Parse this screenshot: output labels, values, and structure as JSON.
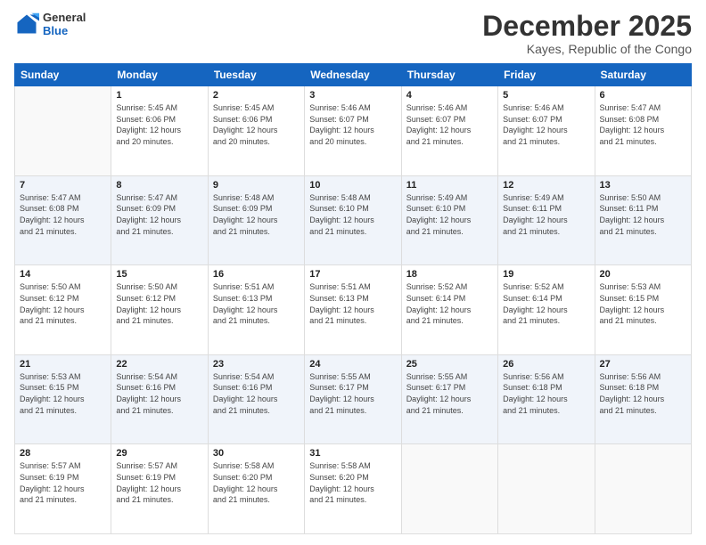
{
  "logo": {
    "line1": "General",
    "line2": "Blue"
  },
  "title": "December 2025",
  "subtitle": "Kayes, Republic of the Congo",
  "days_of_week": [
    "Sunday",
    "Monday",
    "Tuesday",
    "Wednesday",
    "Thursday",
    "Friday",
    "Saturday"
  ],
  "weeks": [
    [
      {
        "num": "",
        "info": ""
      },
      {
        "num": "1",
        "info": "Sunrise: 5:45 AM\nSunset: 6:06 PM\nDaylight: 12 hours\nand 20 minutes."
      },
      {
        "num": "2",
        "info": "Sunrise: 5:45 AM\nSunset: 6:06 PM\nDaylight: 12 hours\nand 20 minutes."
      },
      {
        "num": "3",
        "info": "Sunrise: 5:46 AM\nSunset: 6:07 PM\nDaylight: 12 hours\nand 20 minutes."
      },
      {
        "num": "4",
        "info": "Sunrise: 5:46 AM\nSunset: 6:07 PM\nDaylight: 12 hours\nand 21 minutes."
      },
      {
        "num": "5",
        "info": "Sunrise: 5:46 AM\nSunset: 6:07 PM\nDaylight: 12 hours\nand 21 minutes."
      },
      {
        "num": "6",
        "info": "Sunrise: 5:47 AM\nSunset: 6:08 PM\nDaylight: 12 hours\nand 21 minutes."
      }
    ],
    [
      {
        "num": "7",
        "info": "Sunrise: 5:47 AM\nSunset: 6:08 PM\nDaylight: 12 hours\nand 21 minutes."
      },
      {
        "num": "8",
        "info": "Sunrise: 5:47 AM\nSunset: 6:09 PM\nDaylight: 12 hours\nand 21 minutes."
      },
      {
        "num": "9",
        "info": "Sunrise: 5:48 AM\nSunset: 6:09 PM\nDaylight: 12 hours\nand 21 minutes."
      },
      {
        "num": "10",
        "info": "Sunrise: 5:48 AM\nSunset: 6:10 PM\nDaylight: 12 hours\nand 21 minutes."
      },
      {
        "num": "11",
        "info": "Sunrise: 5:49 AM\nSunset: 6:10 PM\nDaylight: 12 hours\nand 21 minutes."
      },
      {
        "num": "12",
        "info": "Sunrise: 5:49 AM\nSunset: 6:11 PM\nDaylight: 12 hours\nand 21 minutes."
      },
      {
        "num": "13",
        "info": "Sunrise: 5:50 AM\nSunset: 6:11 PM\nDaylight: 12 hours\nand 21 minutes."
      }
    ],
    [
      {
        "num": "14",
        "info": "Sunrise: 5:50 AM\nSunset: 6:12 PM\nDaylight: 12 hours\nand 21 minutes."
      },
      {
        "num": "15",
        "info": "Sunrise: 5:50 AM\nSunset: 6:12 PM\nDaylight: 12 hours\nand 21 minutes."
      },
      {
        "num": "16",
        "info": "Sunrise: 5:51 AM\nSunset: 6:13 PM\nDaylight: 12 hours\nand 21 minutes."
      },
      {
        "num": "17",
        "info": "Sunrise: 5:51 AM\nSunset: 6:13 PM\nDaylight: 12 hours\nand 21 minutes."
      },
      {
        "num": "18",
        "info": "Sunrise: 5:52 AM\nSunset: 6:14 PM\nDaylight: 12 hours\nand 21 minutes."
      },
      {
        "num": "19",
        "info": "Sunrise: 5:52 AM\nSunset: 6:14 PM\nDaylight: 12 hours\nand 21 minutes."
      },
      {
        "num": "20",
        "info": "Sunrise: 5:53 AM\nSunset: 6:15 PM\nDaylight: 12 hours\nand 21 minutes."
      }
    ],
    [
      {
        "num": "21",
        "info": "Sunrise: 5:53 AM\nSunset: 6:15 PM\nDaylight: 12 hours\nand 21 minutes."
      },
      {
        "num": "22",
        "info": "Sunrise: 5:54 AM\nSunset: 6:16 PM\nDaylight: 12 hours\nand 21 minutes."
      },
      {
        "num": "23",
        "info": "Sunrise: 5:54 AM\nSunset: 6:16 PM\nDaylight: 12 hours\nand 21 minutes."
      },
      {
        "num": "24",
        "info": "Sunrise: 5:55 AM\nSunset: 6:17 PM\nDaylight: 12 hours\nand 21 minutes."
      },
      {
        "num": "25",
        "info": "Sunrise: 5:55 AM\nSunset: 6:17 PM\nDaylight: 12 hours\nand 21 minutes."
      },
      {
        "num": "26",
        "info": "Sunrise: 5:56 AM\nSunset: 6:18 PM\nDaylight: 12 hours\nand 21 minutes."
      },
      {
        "num": "27",
        "info": "Sunrise: 5:56 AM\nSunset: 6:18 PM\nDaylight: 12 hours\nand 21 minutes."
      }
    ],
    [
      {
        "num": "28",
        "info": "Sunrise: 5:57 AM\nSunset: 6:19 PM\nDaylight: 12 hours\nand 21 minutes."
      },
      {
        "num": "29",
        "info": "Sunrise: 5:57 AM\nSunset: 6:19 PM\nDaylight: 12 hours\nand 21 minutes."
      },
      {
        "num": "30",
        "info": "Sunrise: 5:58 AM\nSunset: 6:20 PM\nDaylight: 12 hours\nand 21 minutes."
      },
      {
        "num": "31",
        "info": "Sunrise: 5:58 AM\nSunset: 6:20 PM\nDaylight: 12 hours\nand 21 minutes."
      },
      {
        "num": "",
        "info": ""
      },
      {
        "num": "",
        "info": ""
      },
      {
        "num": "",
        "info": ""
      }
    ]
  ]
}
